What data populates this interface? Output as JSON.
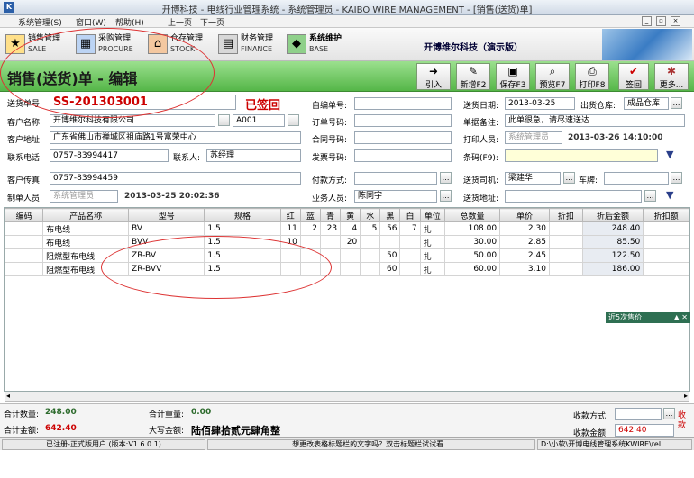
{
  "window": {
    "title": "开博科技 - 电线行业管理系统 - 系统管理员 - KAIBO WIRE MANAGEMENT - [销售(送货)单]",
    "logo": "K"
  },
  "menu": [
    "系统管理(S)",
    "窗口(W)",
    "帮助(H)",
    "上一页",
    "下一页"
  ],
  "window_controls": [
    "_",
    "▫",
    "×"
  ],
  "modules": [
    {
      "zh": "销售管理",
      "en": "SALE",
      "icon": "sale-icon"
    },
    {
      "zh": "采购管理",
      "en": "PROCURE",
      "icon": "procure-icon"
    },
    {
      "zh": "仓存管理",
      "en": "STOCK",
      "icon": "stock-icon"
    },
    {
      "zh": "财务管理",
      "en": "FINANCE",
      "icon": "finance-icon"
    },
    {
      "zh": "系统维护",
      "en": "BASE",
      "icon": "base-icon"
    }
  ],
  "company": "开博维尔科技（演示版）",
  "page_title": "销售(送货)单 - 编辑",
  "toolbar": [
    {
      "label": "引入",
      "glyph": "➜"
    },
    {
      "label": "新增F2",
      "glyph": "✎"
    },
    {
      "label": "保存F3",
      "glyph": "▣"
    },
    {
      "label": "预览F7",
      "glyph": "⌕"
    },
    {
      "label": "打印F8",
      "glyph": "⎙"
    },
    {
      "label": "签回",
      "glyph": "✔"
    },
    {
      "label": "更多...",
      "glyph": "✱"
    }
  ],
  "form": {
    "doc_no_label": "送货单号:",
    "doc_no": "SS-201303001",
    "signed": "已签回",
    "self_no_label": "自编单号:",
    "self_no": "",
    "ship_date_label": "送货日期:",
    "ship_date": "2013-03-25",
    "warehouse_label": "出货仓库:",
    "warehouse": "成品仓库",
    "customer_label": "客户名称:",
    "customer": "开博维尔科技有限公司",
    "customer_code": "A001",
    "order_no_label": "订单号码:",
    "order_no": "",
    "remark_label": "单据备注:",
    "remark": "此单很急，请尽速送达",
    "address_label": "客户地址:",
    "address": "广东省佛山市禅城区祖庙路1号富荣中心",
    "contract_label": "合同号码:",
    "contract": "",
    "printer_label": "打印人员:",
    "printer": "系统管理员",
    "print_time": "2013-03-26 14:10:00",
    "phone_label": "联系电话:",
    "phone": "0757-83994417",
    "contact_label": "联系人:",
    "contact": "苏经理",
    "invoice_label": "发票号码:",
    "invoice": "",
    "barcode_label": "条码(F9):",
    "barcode": "",
    "fax_label": "客户传真:",
    "fax": "0757-83994459",
    "payment_label": "付款方式:",
    "payment": "",
    "driver_label": "送货司机:",
    "driver": "梁建华",
    "vehicle_label": "车牌:",
    "vehicle": "",
    "maker_label": "制单人员:",
    "maker": "系统管理员",
    "make_time": "2013-03-25 20:02:36",
    "sales_label": "业务人员:",
    "sales": "陈同宇",
    "ship_addr_label": "送货地址:",
    "ship_addr": ""
  },
  "table": {
    "headers": [
      "编码",
      "产品名称",
      "型号",
      "规格",
      "红",
      "蓝",
      "青",
      "黄",
      "水",
      "黑",
      "白",
      "单位",
      "总数量",
      "单价",
      "折扣",
      "折后金额",
      "折扣额"
    ],
    "rows": [
      [
        "",
        "布电线",
        "BV",
        "1.5",
        "11",
        "2",
        "23",
        "4",
        "5",
        "56",
        "7",
        "扎",
        "108.00",
        "2.30",
        "",
        "248.40",
        ""
      ],
      [
        "",
        "布电线",
        "BVV",
        "1.5",
        "10",
        "",
        "",
        "20",
        "",
        "",
        "",
        "扎",
        "30.00",
        "2.85",
        "",
        "85.50",
        ""
      ],
      [
        "",
        "阻燃型布电线",
        "ZR-BV",
        "1.5",
        "",
        "",
        "",
        "",
        "",
        "50",
        "",
        "扎",
        "50.00",
        "2.45",
        "",
        "122.50",
        ""
      ],
      [
        "",
        "阻燃型布电线",
        "ZR-BVV",
        "1.5",
        "",
        "",
        "",
        "",
        "",
        "60",
        "",
        "扎",
        "60.00",
        "3.10",
        "",
        "186.00",
        ""
      ]
    ]
  },
  "side_panel": {
    "title": "近5次售价",
    "controls": "▲ ✕"
  },
  "footer": {
    "total_qty_label": "合计数量:",
    "total_qty": "248.00",
    "total_weight_label": "合计重量:",
    "total_weight": "0.00",
    "total_amount_label": "合计金额:",
    "total_amount": "642.40",
    "upper_label": "大写金额:",
    "upper": "陆佰肆拾贰元肆角整",
    "receipt_method_label": "收款方式:",
    "receipt_method": "",
    "receipt_amount_label": "收款金额:",
    "receipt_amount": "642.40",
    "receipt_side": "收款"
  },
  "status": {
    "reg": "已注册-正式版用户 (版本:V1.6.0.1)",
    "hint": "想更改表格标题栏的文字吗？双击标题栏试试看...",
    "path": "D:\\小软\\开博电线管理系统KWIRE\\rel"
  },
  "colors": {
    "header_green": "#55b648",
    "doc_red": "#cc0000",
    "annotation_red": "#dd3333"
  }
}
